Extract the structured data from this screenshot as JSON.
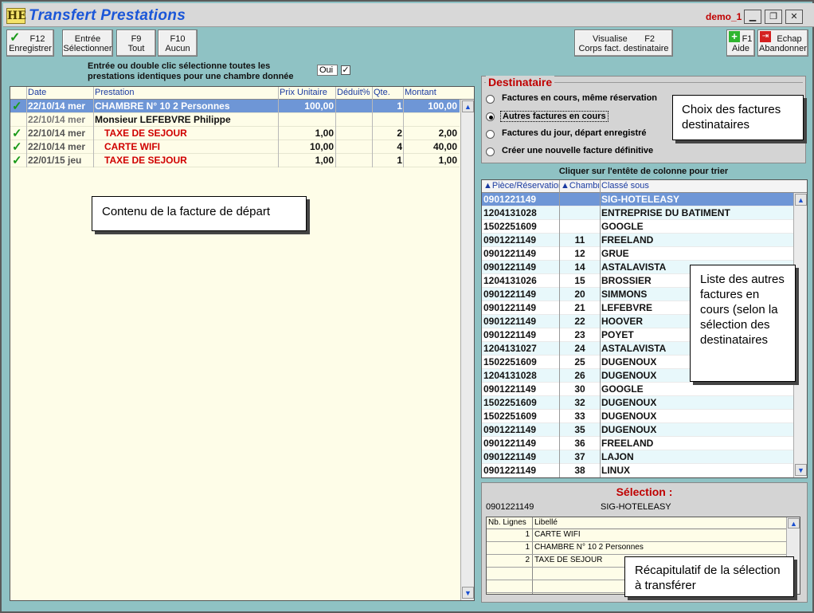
{
  "window": {
    "title": "Transfert Prestations",
    "logo": "HE",
    "user": "demo_1",
    "controls": [
      "minimize-icon",
      "restore-icon",
      "close-icon"
    ]
  },
  "toolbar": {
    "save": {
      "key": "F12",
      "label": "Enregistrer"
    },
    "select": {
      "key": "Entrée",
      "label": "Sélectionner"
    },
    "all": {
      "key": "F9",
      "label": "Tout"
    },
    "none": {
      "key": "F10",
      "label": "Aucun"
    },
    "view": {
      "key": "Visualise",
      "key2": "F2",
      "label": "Corps fact. destinataire"
    },
    "help": {
      "key": "F1",
      "label": "Aide"
    },
    "cancel": {
      "key": "Echap",
      "label": "Abandonner"
    }
  },
  "hint": {
    "line1": "Entrée ou double clic sélectionne toutes les",
    "line2": "prestations identiques pour une chambre donnée",
    "select_value": "Oui",
    "checked": true
  },
  "source_table": {
    "columns": [
      "Date",
      "Prestation",
      "Prix Unitaire",
      "Déduit%",
      "Qte.",
      "Montant"
    ],
    "rows": [
      {
        "check": "✓",
        "date": "22/10/14 mer",
        "prestation": "CHAMBRE N° 10 2 Personnes",
        "prix": "100,00",
        "deduit": "",
        "qte": "1",
        "montant": "100,00"
      },
      {
        "check": "",
        "date": "22/10/14 mer",
        "prestation": "Monsieur LEFEBVRE Philippe",
        "prix": "",
        "deduit": "",
        "qte": "",
        "montant": ""
      },
      {
        "check": "✓",
        "date": "22/10/14 mer",
        "prestation": "TAXE DE SEJOUR",
        "prix": "1,00",
        "deduit": "",
        "qte": "2",
        "montant": "2,00"
      },
      {
        "check": "✓",
        "date": "22/10/14 mer",
        "prestation": "CARTE WIFI",
        "prix": "10,00",
        "deduit": "",
        "qte": "4",
        "montant": "40,00"
      },
      {
        "check": "✓",
        "date": "22/01/15 jeu",
        "prestation": "TAXE DE SEJOUR",
        "prix": "1,00",
        "deduit": "",
        "qte": "1",
        "montant": "1,00"
      }
    ]
  },
  "destinataire": {
    "legend": "Destinataire",
    "options": [
      "Factures en cours, même réservation",
      "Autres factures en cours",
      "Factures du jour, départ enregistré",
      "Créer une nouvelle facture définitive"
    ],
    "selected": 1
  },
  "sort_hint": "Cliquer sur l'entête de colonne pour trier",
  "dest_table": {
    "columns": [
      "Pièce/Réservation",
      "Chambre",
      "Classé sous"
    ],
    "rows": [
      [
        "0901221149",
        "",
        "SIG-HOTELEASY"
      ],
      [
        "1204131028",
        "",
        "ENTREPRISE DU BATIMENT"
      ],
      [
        "1502251609",
        "",
        "GOOGLE"
      ],
      [
        "0901221149",
        "11",
        "FREELAND"
      ],
      [
        "0901221149",
        "12",
        "GRUE"
      ],
      [
        "0901221149",
        "14",
        "ASTALAVISTA"
      ],
      [
        "1204131026",
        "15",
        "BROSSIER"
      ],
      [
        "0901221149",
        "20",
        "SIMMONS"
      ],
      [
        "0901221149",
        "21",
        "LEFEBVRE"
      ],
      [
        "0901221149",
        "22",
        "HOOVER"
      ],
      [
        "0901221149",
        "23",
        "POYET"
      ],
      [
        "1204131027",
        "24",
        "ASTALAVISTA"
      ],
      [
        "1502251609",
        "25",
        "DUGENOUX"
      ],
      [
        "1204131028",
        "26",
        "DUGENOUX"
      ],
      [
        "0901221149",
        "30",
        "GOOGLE"
      ],
      [
        "1502251609",
        "32",
        "DUGENOUX"
      ],
      [
        "1502251609",
        "33",
        "DUGENOUX"
      ],
      [
        "0901221149",
        "35",
        "DUGENOUX"
      ],
      [
        "0901221149",
        "36",
        "FREELAND"
      ],
      [
        "0901221149",
        "37",
        "LAJON"
      ],
      [
        "0901221149",
        "38",
        "LINUX"
      ]
    ]
  },
  "selection": {
    "title": "Sélection :",
    "piece": "0901221149",
    "name": "SIG-HOTELEASY",
    "columns": [
      "Nb. Lignes",
      "Libellé"
    ],
    "rows": [
      [
        "1",
        "CARTE WIFI"
      ],
      [
        "1",
        "CHAMBRE N° 10 2 Personnes"
      ],
      [
        "2",
        "TAXE DE SEJOUR"
      ]
    ]
  },
  "callouts": {
    "contenu": "Contenu de la facture de départ",
    "choix": "Choix des factures destinataires",
    "liste": "Liste des autres factures en cours (selon la sélection des destinataires",
    "recap": "Récapitulatif de la sélection à transférer"
  },
  "colors": {
    "background": "#8fc2c4",
    "selected_row": "#6e96d6",
    "red_text": "#d00000",
    "title_blue": "#1a56d8"
  }
}
